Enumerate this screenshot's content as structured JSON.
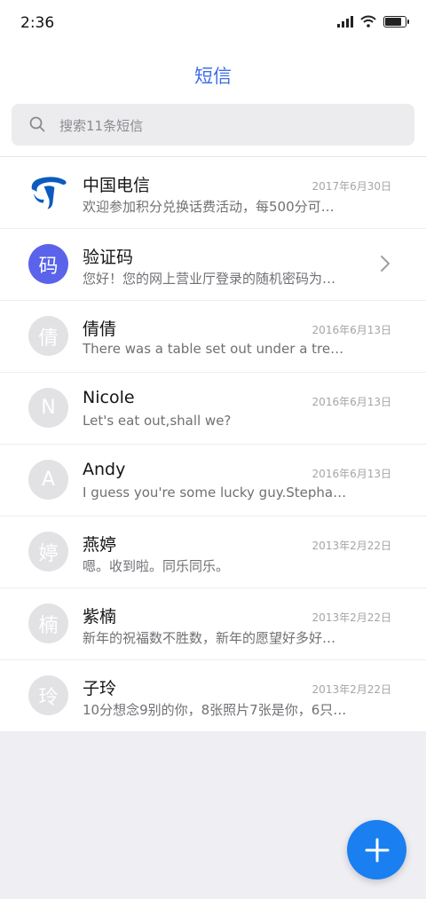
{
  "status": {
    "time": "2:36"
  },
  "header": {
    "title": "短信"
  },
  "search": {
    "placeholder": "搜索11条短信"
  },
  "messages": [
    {
      "avatar": "",
      "name": "中国电信",
      "date": "2017年6月30日",
      "preview": "欢迎参加积分兑换话费活动，每500分可…"
    },
    {
      "avatar": "码",
      "name": "验证码",
      "date": "",
      "preview": "您好！您的网上营业厅登录的随机密码为…"
    },
    {
      "avatar": "倩",
      "name": "倩倩",
      "date": "2016年6月13日",
      "preview": "There was a table set out under a tree i…"
    },
    {
      "avatar": "N",
      "name": "Nicole",
      "date": "2016年6月13日",
      "preview": "Let's eat out,shall we?"
    },
    {
      "avatar": "A",
      "name": "Andy",
      "date": "2016年6月13日",
      "preview": "I guess you're some lucky guy.Stepha…"
    },
    {
      "avatar": "婷",
      "name": "燕婷",
      "date": "2013年2月22日",
      "preview": "嗯。收到啦。同乐同乐。"
    },
    {
      "avatar": "楠",
      "name": "紫楠",
      "date": "2013年2月22日",
      "preview": "新年的祝福数不胜数，新年的愿望好多好…"
    },
    {
      "avatar": "玲",
      "name": "子玲",
      "date": "2013年2月22日",
      "preview": "10分想念9别的你，8张照片7张是你，6只…"
    }
  ],
  "icons": {
    "search": "search-icon",
    "chevron": "chevron-right-icon",
    "compose": "plus-icon",
    "carrier_logo": "china-telecom-logo-icon"
  },
  "colors": {
    "accent": "#3d6ee9",
    "fab": "#1a7ff0",
    "avatar_blue": "#5a63ea",
    "avatar_gray": "#e2e2e4"
  }
}
